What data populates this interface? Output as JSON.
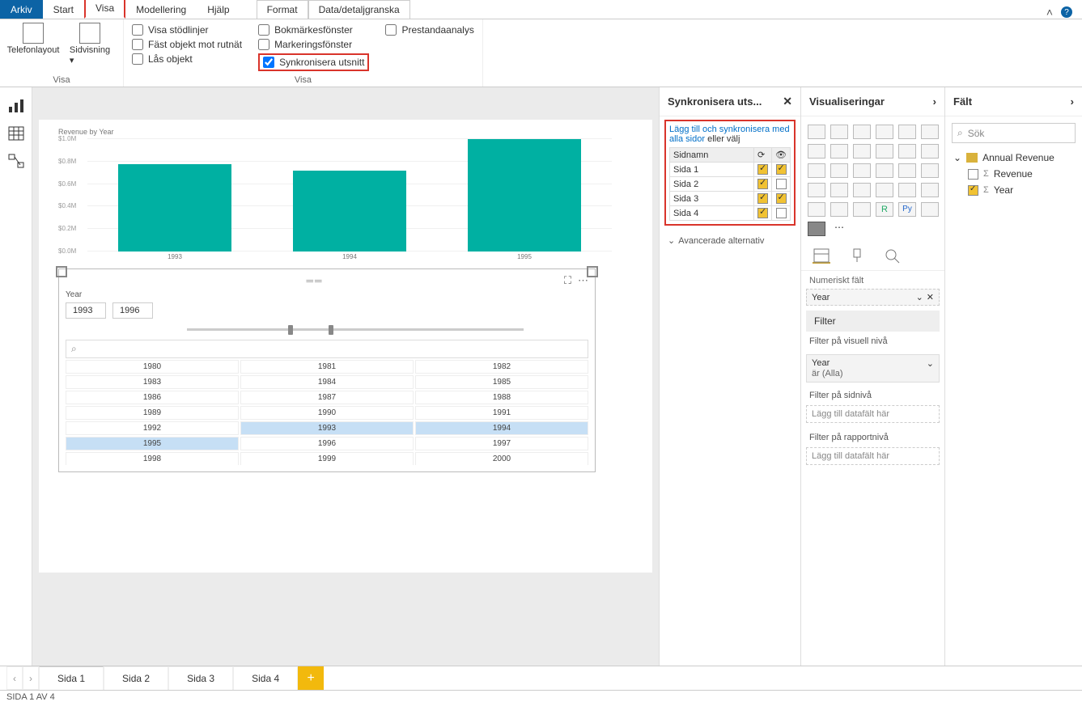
{
  "menu": {
    "arkiv": "Arkiv",
    "start": "Start",
    "visa": "Visa",
    "modellering": "Modellering",
    "hjalp": "Hjälp",
    "format": "Format",
    "data": "Data/detaljgranska"
  },
  "ribbon": {
    "telefon": "Telefonlayout",
    "sidv": "Sidvisning",
    "group_visa": "Visa",
    "chk_stodlinjer": "Visa stödlinjer",
    "chk_fast": "Fäst objekt mot rutnät",
    "chk_las": "Lås objekt",
    "chk_bokmarke": "Bokmärkesfönster",
    "chk_markering": "Markeringsfönster",
    "chk_sync": "Synkronisera utsnitt",
    "chk_prestanda": "Prestandaanalys",
    "group_visa2": "Visa"
  },
  "chart_data": {
    "type": "bar",
    "title": "Revenue by Year",
    "categories": [
      "1993",
      "1994",
      "1995"
    ],
    "values": [
      0.78,
      0.72,
      1.0
    ],
    "ylabel": "",
    "yticks": [
      "$0.0M",
      "$0.2M",
      "$0.4M",
      "$0.6M",
      "$0.8M",
      "$1.0M"
    ],
    "ylim": [
      0,
      1.0
    ]
  },
  "slicer": {
    "field": "Year",
    "from": "1993",
    "to": "1996",
    "search_icon": "⌕",
    "years": [
      "1980",
      "1981",
      "1982",
      "1983",
      "1984",
      "1985",
      "1986",
      "1987",
      "1988",
      "1989",
      "1990",
      "1991",
      "1992",
      "1993",
      "1994",
      "1995",
      "1996",
      "1997",
      "1998",
      "1999",
      "2000"
    ],
    "selected": [
      "1993",
      "1994",
      "1995"
    ]
  },
  "sync": {
    "title": "Synkronisera uts...",
    "link": "Lägg till och synkronisera med alla sidor",
    "or": " eller välj",
    "col_sidnamn": "Sidnamn",
    "pages": [
      {
        "name": "Sida 1",
        "sync": true,
        "visible": true
      },
      {
        "name": "Sida 2",
        "sync": true,
        "visible": false
      },
      {
        "name": "Sida 3",
        "sync": true,
        "visible": true
      },
      {
        "name": "Sida 4",
        "sync": true,
        "visible": false
      }
    ],
    "adv": "Avancerade alternativ"
  },
  "viz": {
    "title": "Visualiseringar",
    "section": "Numeriskt fält",
    "field": "Year",
    "filter_hdr": "Filter",
    "f_visual": "Filter på visuell nivå",
    "f_year": "Year",
    "f_year_sub": "är (Alla)",
    "f_page": "Filter på sidnivå",
    "f_report": "Filter på rapportnivå",
    "drop": "Lägg till datafält här"
  },
  "falt": {
    "title": "Fält",
    "search": "Sök",
    "table": "Annual Revenue",
    "fields": [
      {
        "name": "Revenue",
        "on": false
      },
      {
        "name": "Year",
        "on": true
      }
    ]
  },
  "pagetabs": [
    "Sida 1",
    "Sida 2",
    "Sida 3",
    "Sida 4"
  ],
  "status": "SIDA 1 AV 4"
}
